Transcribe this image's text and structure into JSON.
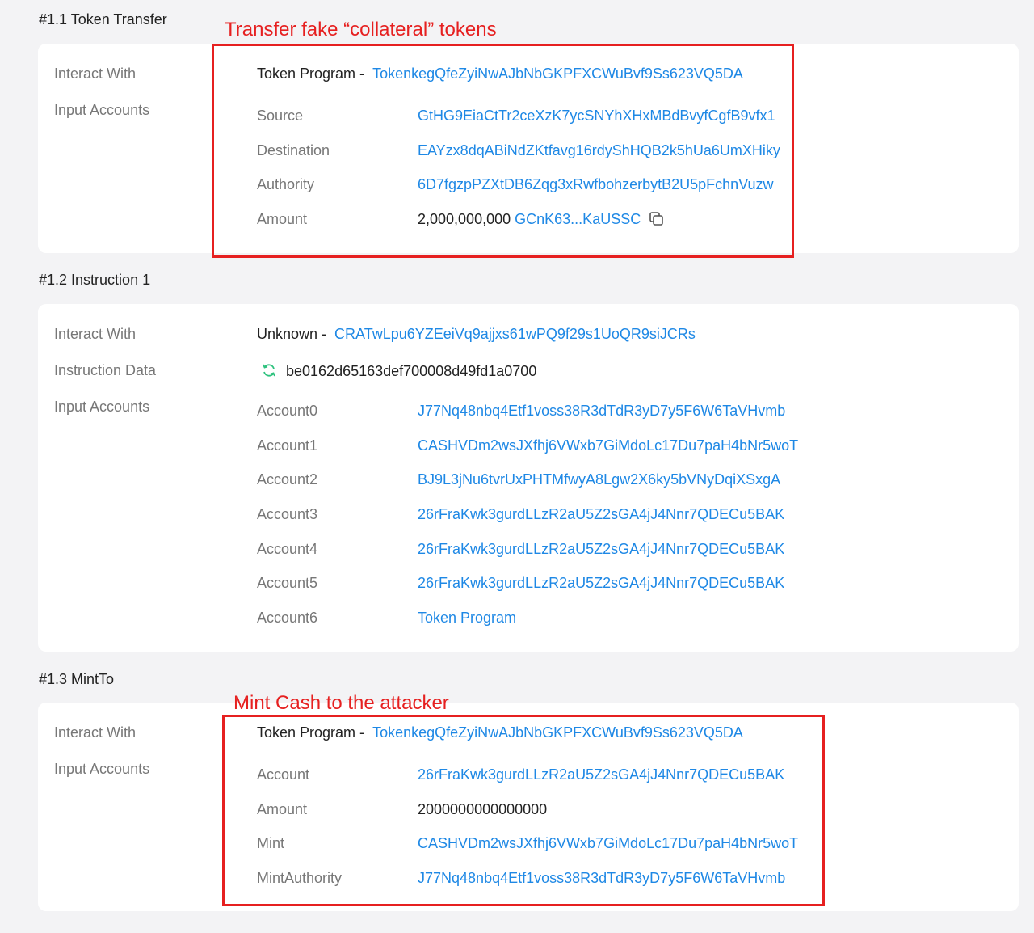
{
  "sections": [
    {
      "title": "#1.1 Token Transfer",
      "labels": {
        "interact_with": "Interact With",
        "input_accounts": "Input Accounts"
      },
      "program_name": "Token Program -",
      "program_address": "TokenkegQfeZyiNwAJbNbGKPFXCWuBvf9Ss623VQ5DA",
      "rows": [
        {
          "key": "Source",
          "value": "GtHG9EiaCtTr2ceXzK7ycSNYhXHxMBdBvyfCgfB9vfx1"
        },
        {
          "key": "Destination",
          "value": "EAYzx8dqABiNdZKtfavg16rdyShHQB2k5hUa6UmXHiky"
        },
        {
          "key": "Authority",
          "value": "6D7fgzpPZXtDB6Zqg3xRwfbohzerbytB2U5pFchnVuzw"
        },
        {
          "key": "Amount",
          "amount": "2,000,000,000",
          "token": "GCnK63...KaUSSC"
        }
      ],
      "annotation": "Transfer fake “collateral” tokens"
    },
    {
      "title": "#1.2 Instruction 1",
      "labels": {
        "interact_with": "Interact With",
        "instruction_data": "Instruction Data",
        "input_accounts": "Input Accounts"
      },
      "program_name": "Unknown -",
      "program_address": "CRATwLpu6YZEeiVq9ajjxs61wPQ9f29s1UoQR9siJCRs",
      "instruction_data": "be0162d65163def700008d49fd1a0700",
      "rows": [
        {
          "key": "Account0",
          "value": "J77Nq48nbq4Etf1voss38R3dTdR3yD7y5F6W6TaVHvmb"
        },
        {
          "key": "Account1",
          "value": "CASHVDm2wsJXfhj6VWxb7GiMdoLc17Du7paH4bNr5woT"
        },
        {
          "key": "Account2",
          "value": "BJ9L3jNu6tvrUxPHTMfwyA8Lgw2X6ky5bVNyDqiXSxgA"
        },
        {
          "key": "Account3",
          "value": "26rFraKwk3gurdLLzR2aU5Z2sGA4jJ4Nnr7QDECu5BAK"
        },
        {
          "key": "Account4",
          "value": "26rFraKwk3gurdLLzR2aU5Z2sGA4jJ4Nnr7QDECu5BAK"
        },
        {
          "key": "Account5",
          "value": "26rFraKwk3gurdLLzR2aU5Z2sGA4jJ4Nnr7QDECu5BAK"
        },
        {
          "key": "Account6",
          "value": "Token Program"
        }
      ]
    },
    {
      "title": "#1.3 MintTo",
      "labels": {
        "interact_with": "Interact With",
        "input_accounts": "Input Accounts"
      },
      "program_name": "Token Program -",
      "program_address": "TokenkegQfeZyiNwAJbNbGKPFXCWuBvf9Ss623VQ5DA",
      "rows": [
        {
          "key": "Account",
          "value": "26rFraKwk3gurdLLzR2aU5Z2sGA4jJ4Nnr7QDECu5BAK"
        },
        {
          "key": "Amount",
          "value": "2000000000000000"
        },
        {
          "key": "Mint",
          "value": "CASHVDm2wsJXfhj6VWxb7GiMdoLc17Du7paH4bNr5woT"
        },
        {
          "key": "MintAuthority",
          "value": "J77Nq48nbq4Etf1voss38R3dTdR3yD7y5F6W6TaVHvmb"
        }
      ],
      "annotation": "Mint Cash to the attacker"
    }
  ],
  "colors": {
    "link": "#1e88e5",
    "annotation": "#e62020",
    "card": "#ffffff",
    "page": "#f3f3f5"
  }
}
